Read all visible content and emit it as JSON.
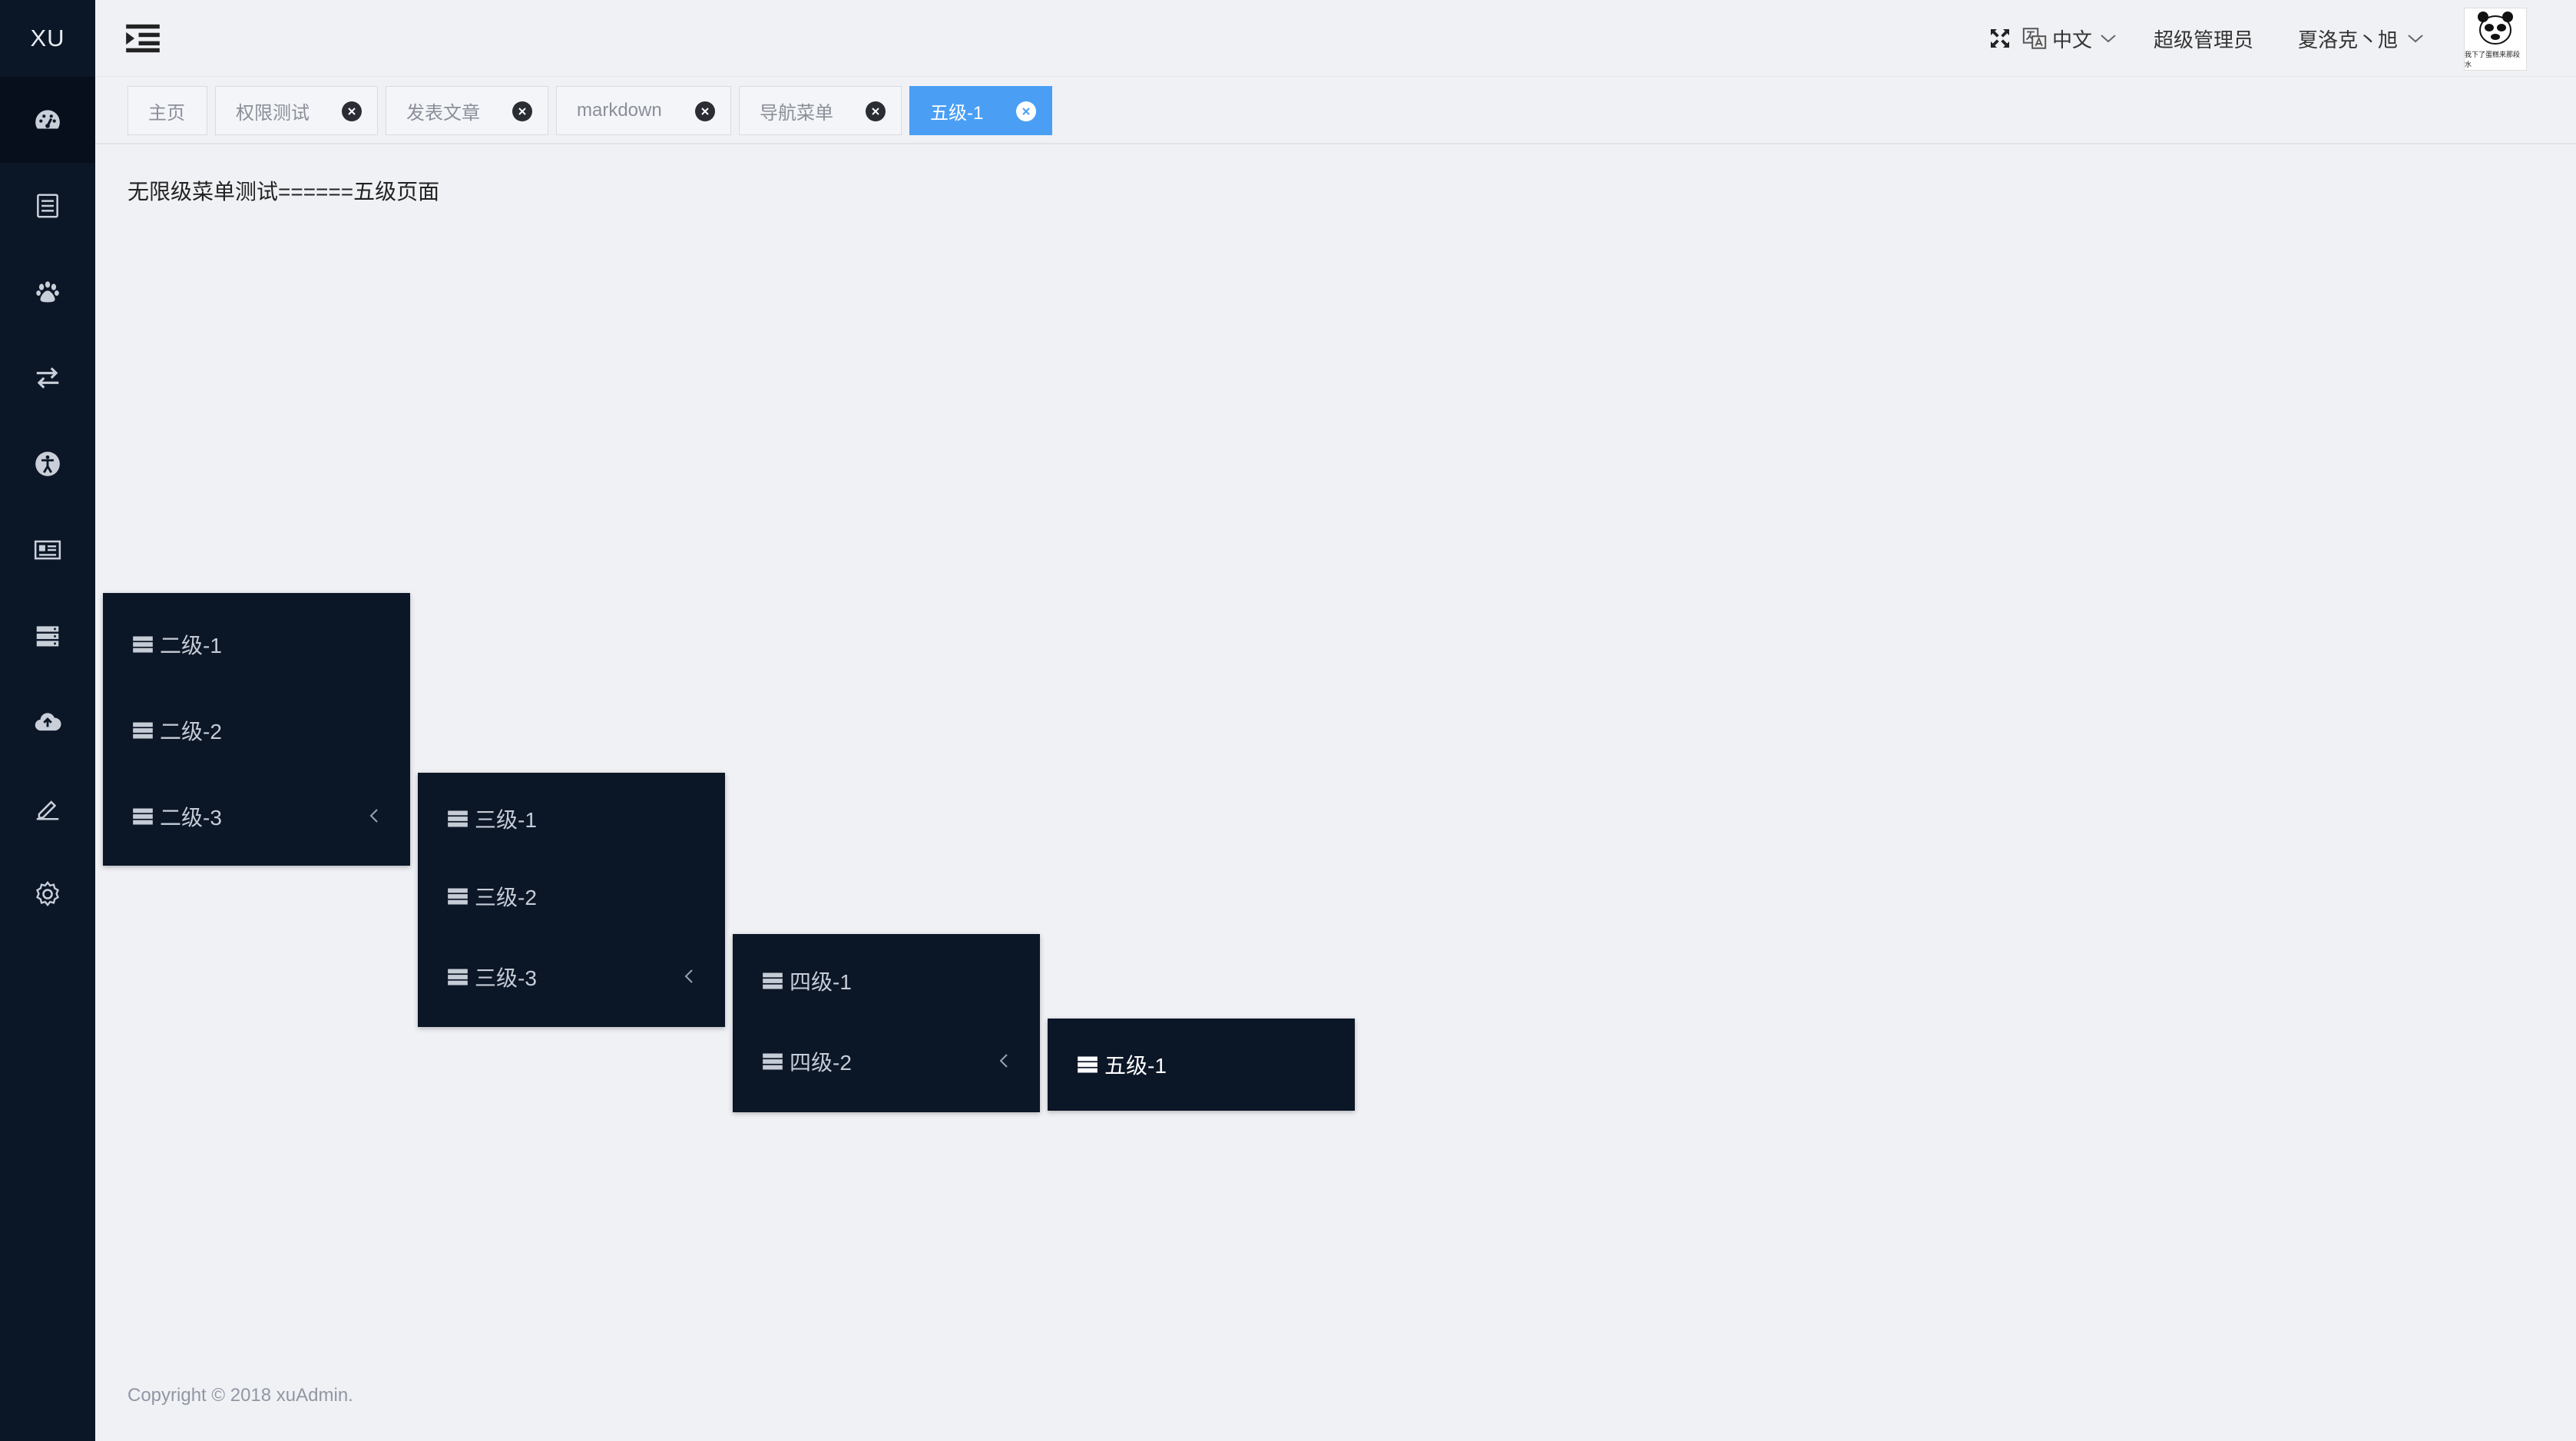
{
  "app": {
    "logo": "XU"
  },
  "sidebar": {
    "icons": [
      "dashboard-icon",
      "document-icon",
      "paw-icon",
      "swap-icon",
      "accessibility-icon",
      "news-icon",
      "server-icon",
      "cloud-upload-icon",
      "edit-icon",
      "settings-icon"
    ]
  },
  "header": {
    "language": "中文",
    "role": "超级管理员",
    "username": "夏洛克丶旭",
    "avatar_caption": "我下了蛋糕来那段水"
  },
  "tabs": [
    {
      "label": "主页",
      "closable": false
    },
    {
      "label": "权限测试",
      "closable": true
    },
    {
      "label": "发表文章",
      "closable": true
    },
    {
      "label": "markdown",
      "closable": true
    },
    {
      "label": "导航菜单",
      "closable": true
    },
    {
      "label": "五级-1",
      "closable": true,
      "active": true
    }
  ],
  "content": {
    "text": "无限级菜单测试======五级页面"
  },
  "menus": {
    "level2": [
      "二级-1",
      "二级-2",
      "二级-3"
    ],
    "level3": [
      "三级-1",
      "三级-2",
      "三级-3"
    ],
    "level4": [
      "四级-1",
      "四级-2"
    ],
    "level5": [
      "五级-1"
    ]
  },
  "footer": {
    "copyright": "Copyright © 2018 xuAdmin."
  },
  "colors": {
    "sidebar": "#0b1627",
    "accent": "#4a9ff5",
    "background": "#f0f1f5"
  }
}
